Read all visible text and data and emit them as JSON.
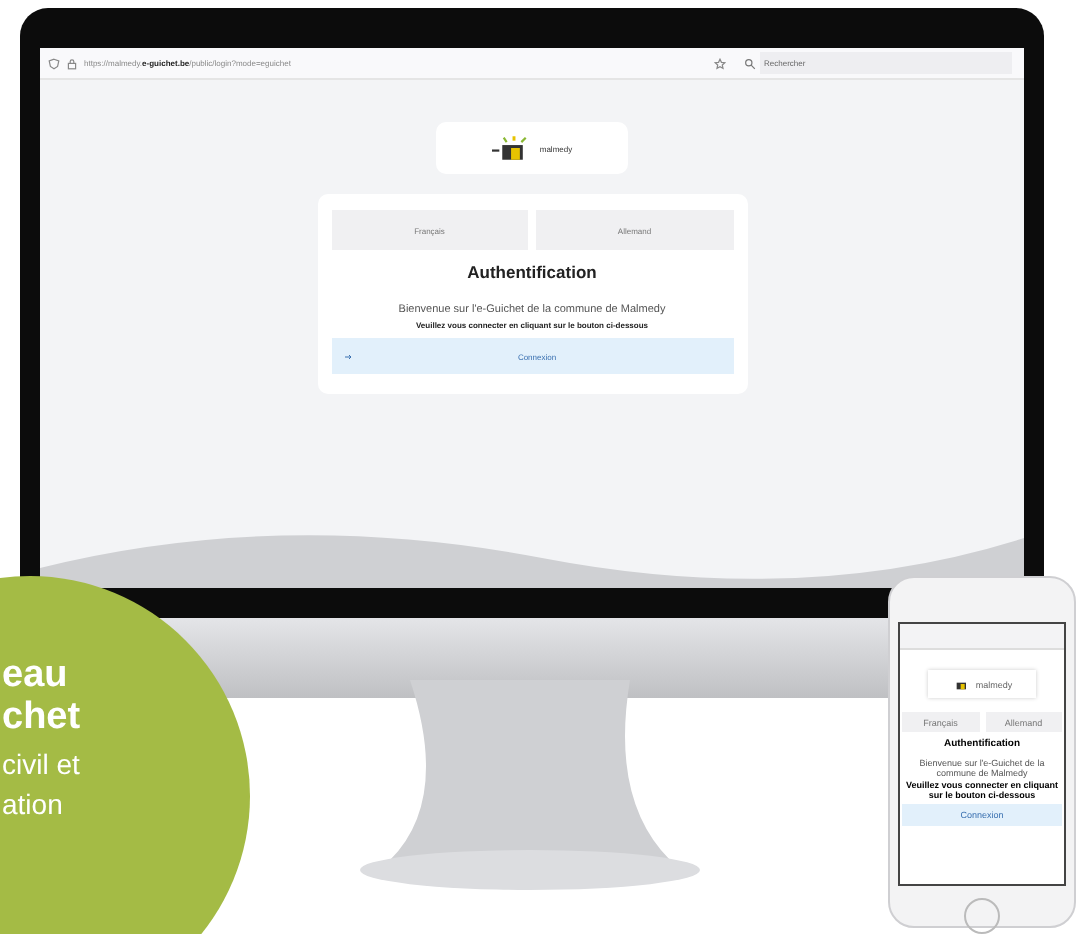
{
  "browser": {
    "url": "https://malmedy.**e-guichet.be**/public/login?mode=eguichet",
    "search_placeholder": "Rechercher"
  },
  "login": {
    "logo_text": "malmedy",
    "tabs": [
      {
        "label": "Français",
        "selected": false
      },
      {
        "label": "Allemand",
        "selected": false
      }
    ],
    "title": "Authentification",
    "welcome": "Bienvenue sur l'e-Guichet de la commune de Malmedy",
    "instruction": "Veuillez vous connecter en cliquant sur le bouton ci-dessous",
    "button": "Connexion"
  },
  "phone": {
    "logo_text": "malmedy",
    "tabs": [
      {
        "label": "Français",
        "selected": false
      },
      {
        "label": "Allemand",
        "selected": false
      }
    ],
    "title": "Authentification",
    "welcome": "Bienvenue sur l'e-Guichet de la commune de Malmedy",
    "instruction": "Veuillez vous connecter en cliquant sur le bouton ci-dessous",
    "button": "Connexion"
  },
  "badge": {
    "lines": [
      {
        "text": "eau",
        "kind": "bold"
      },
      {
        "text": "chet",
        "kind": "bold"
      },
      {
        "text": "civil et",
        "kind": "regular"
      },
      {
        "text": "ation",
        "kind": "regular"
      }
    ]
  }
}
